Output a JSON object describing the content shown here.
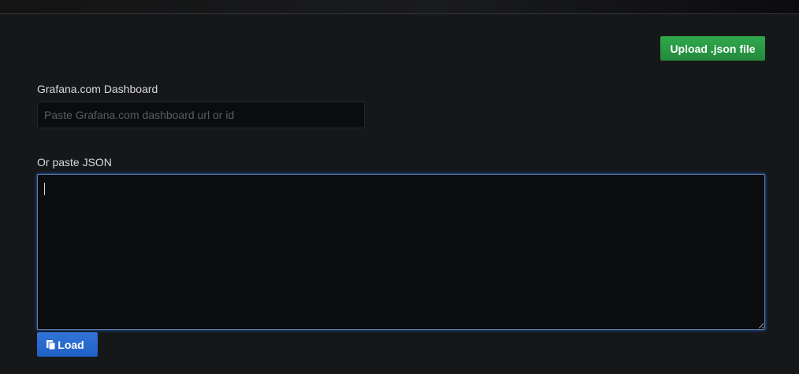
{
  "upload": {
    "label": "Upload .json file"
  },
  "grafana": {
    "label": "Grafana.com Dashboard",
    "placeholder": "Paste Grafana.com dashboard url or id",
    "value": ""
  },
  "json": {
    "label": "Or paste JSON",
    "value": ""
  },
  "load": {
    "label": "Load",
    "icon": "copy-icon"
  },
  "colors": {
    "background": "#161719",
    "upload_button": "#299c46",
    "load_button": "#3274d9",
    "focus_border": "#1f60c4"
  }
}
